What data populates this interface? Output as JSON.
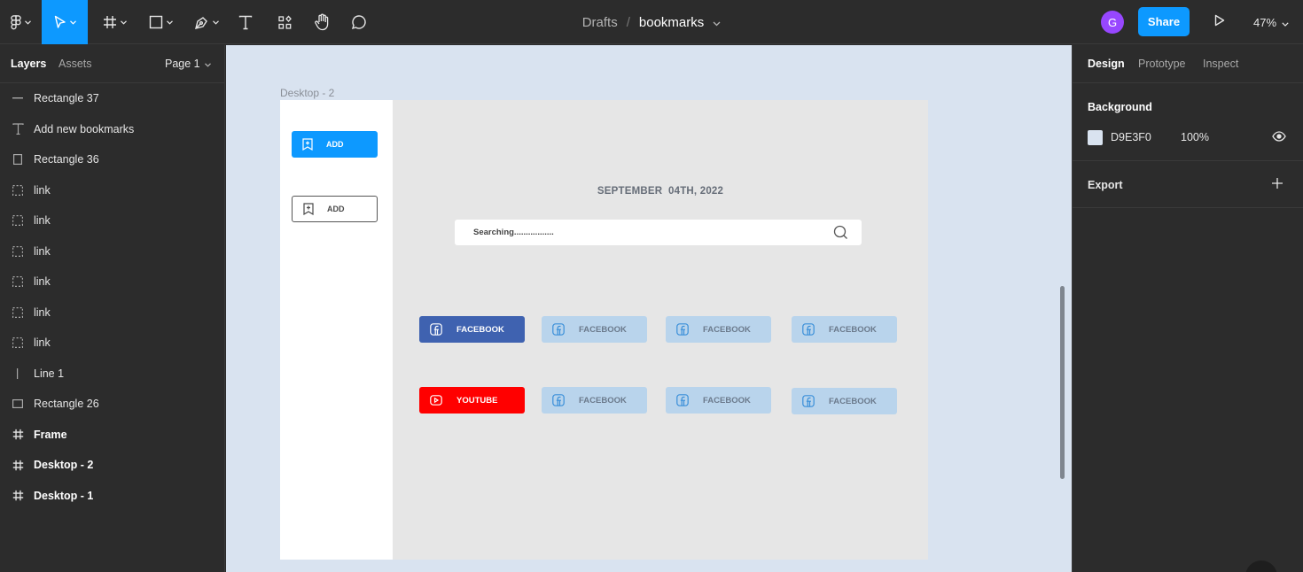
{
  "toolbar": {
    "tools": [
      {
        "name": "main-menu",
        "icon": "figma-logo-icon"
      },
      {
        "name": "move",
        "icon": "cursor-arrow-icon",
        "active": true
      },
      {
        "name": "frame",
        "icon": "frame-hash-icon"
      },
      {
        "name": "shape",
        "icon": "rectangle-icon"
      },
      {
        "name": "pen",
        "icon": "pen-icon"
      },
      {
        "name": "text",
        "icon": "text-icon"
      },
      {
        "name": "resources",
        "icon": "components-icon"
      },
      {
        "name": "hand",
        "icon": "hand-icon"
      },
      {
        "name": "comment",
        "icon": "comment-bubble-icon"
      }
    ],
    "breadcrumb": {
      "folder": "Drafts",
      "separator": "/",
      "file": "bookmarks"
    },
    "avatar_initial": "G",
    "share_label": "Share",
    "zoom_label": "47%",
    "accent_color": "#0d99ff",
    "avatar_color": "#9747ff"
  },
  "left_panel": {
    "tabs": {
      "layers": "Layers",
      "assets": "Assets"
    },
    "page": "Page 1",
    "layers": [
      {
        "label": "Rectangle 37",
        "icon": "line-icon",
        "frame": false
      },
      {
        "label": "Add new bookmarks",
        "icon": "text-icon",
        "frame": false
      },
      {
        "label": "Rectangle 36",
        "icon": "rectangle-icon",
        "frame": false
      },
      {
        "label": "link",
        "icon": "dashed-frame-icon",
        "frame": false
      },
      {
        "label": "link",
        "icon": "dashed-frame-icon",
        "frame": false
      },
      {
        "label": "link",
        "icon": "dashed-frame-icon",
        "frame": false
      },
      {
        "label": "link",
        "icon": "dashed-frame-icon",
        "frame": false
      },
      {
        "label": "link",
        "icon": "dashed-frame-icon",
        "frame": false
      },
      {
        "label": "link",
        "icon": "dashed-frame-icon",
        "frame": false
      },
      {
        "label": "Line 1",
        "icon": "vertical-line-icon",
        "frame": false
      },
      {
        "label": "Rectangle 26",
        "icon": "rectangle-icon",
        "frame": false
      },
      {
        "label": "Frame",
        "icon": "frame-hash-icon",
        "frame": true
      },
      {
        "label": "Desktop - 2",
        "icon": "frame-hash-icon",
        "frame": true
      },
      {
        "label": "Desktop - 1",
        "icon": "frame-hash-icon",
        "frame": true
      }
    ]
  },
  "canvas": {
    "background_color": "#d9e3f0",
    "frame_label": "Desktop - 2",
    "design": {
      "add_buttons": [
        "ADD",
        "ADD"
      ],
      "date": "SEPTEMBER  04TH, 2022",
      "search_placeholder": "Searching.................",
      "bookmarks_row1": [
        "FACEBOOK",
        "FACEBOOK",
        "FACEBOOK",
        "FACEBOOK"
      ],
      "bookmarks_row2": [
        "YOUTUBE",
        "FACEBOOK",
        "FACEBOOK",
        "FACEBOOK"
      ],
      "colors": {
        "facebook_active": "#3f62b0",
        "youtube": "#ff0000",
        "facebook_light": "#b9d4ec",
        "add_blue": "#0d99ff"
      }
    }
  },
  "right_panel": {
    "tabs": {
      "design": "Design",
      "prototype": "Prototype",
      "inspect": "Inspect"
    },
    "background": {
      "title": "Background",
      "hex": "D9E3F0",
      "opacity": "100%"
    },
    "export": {
      "title": "Export"
    }
  }
}
